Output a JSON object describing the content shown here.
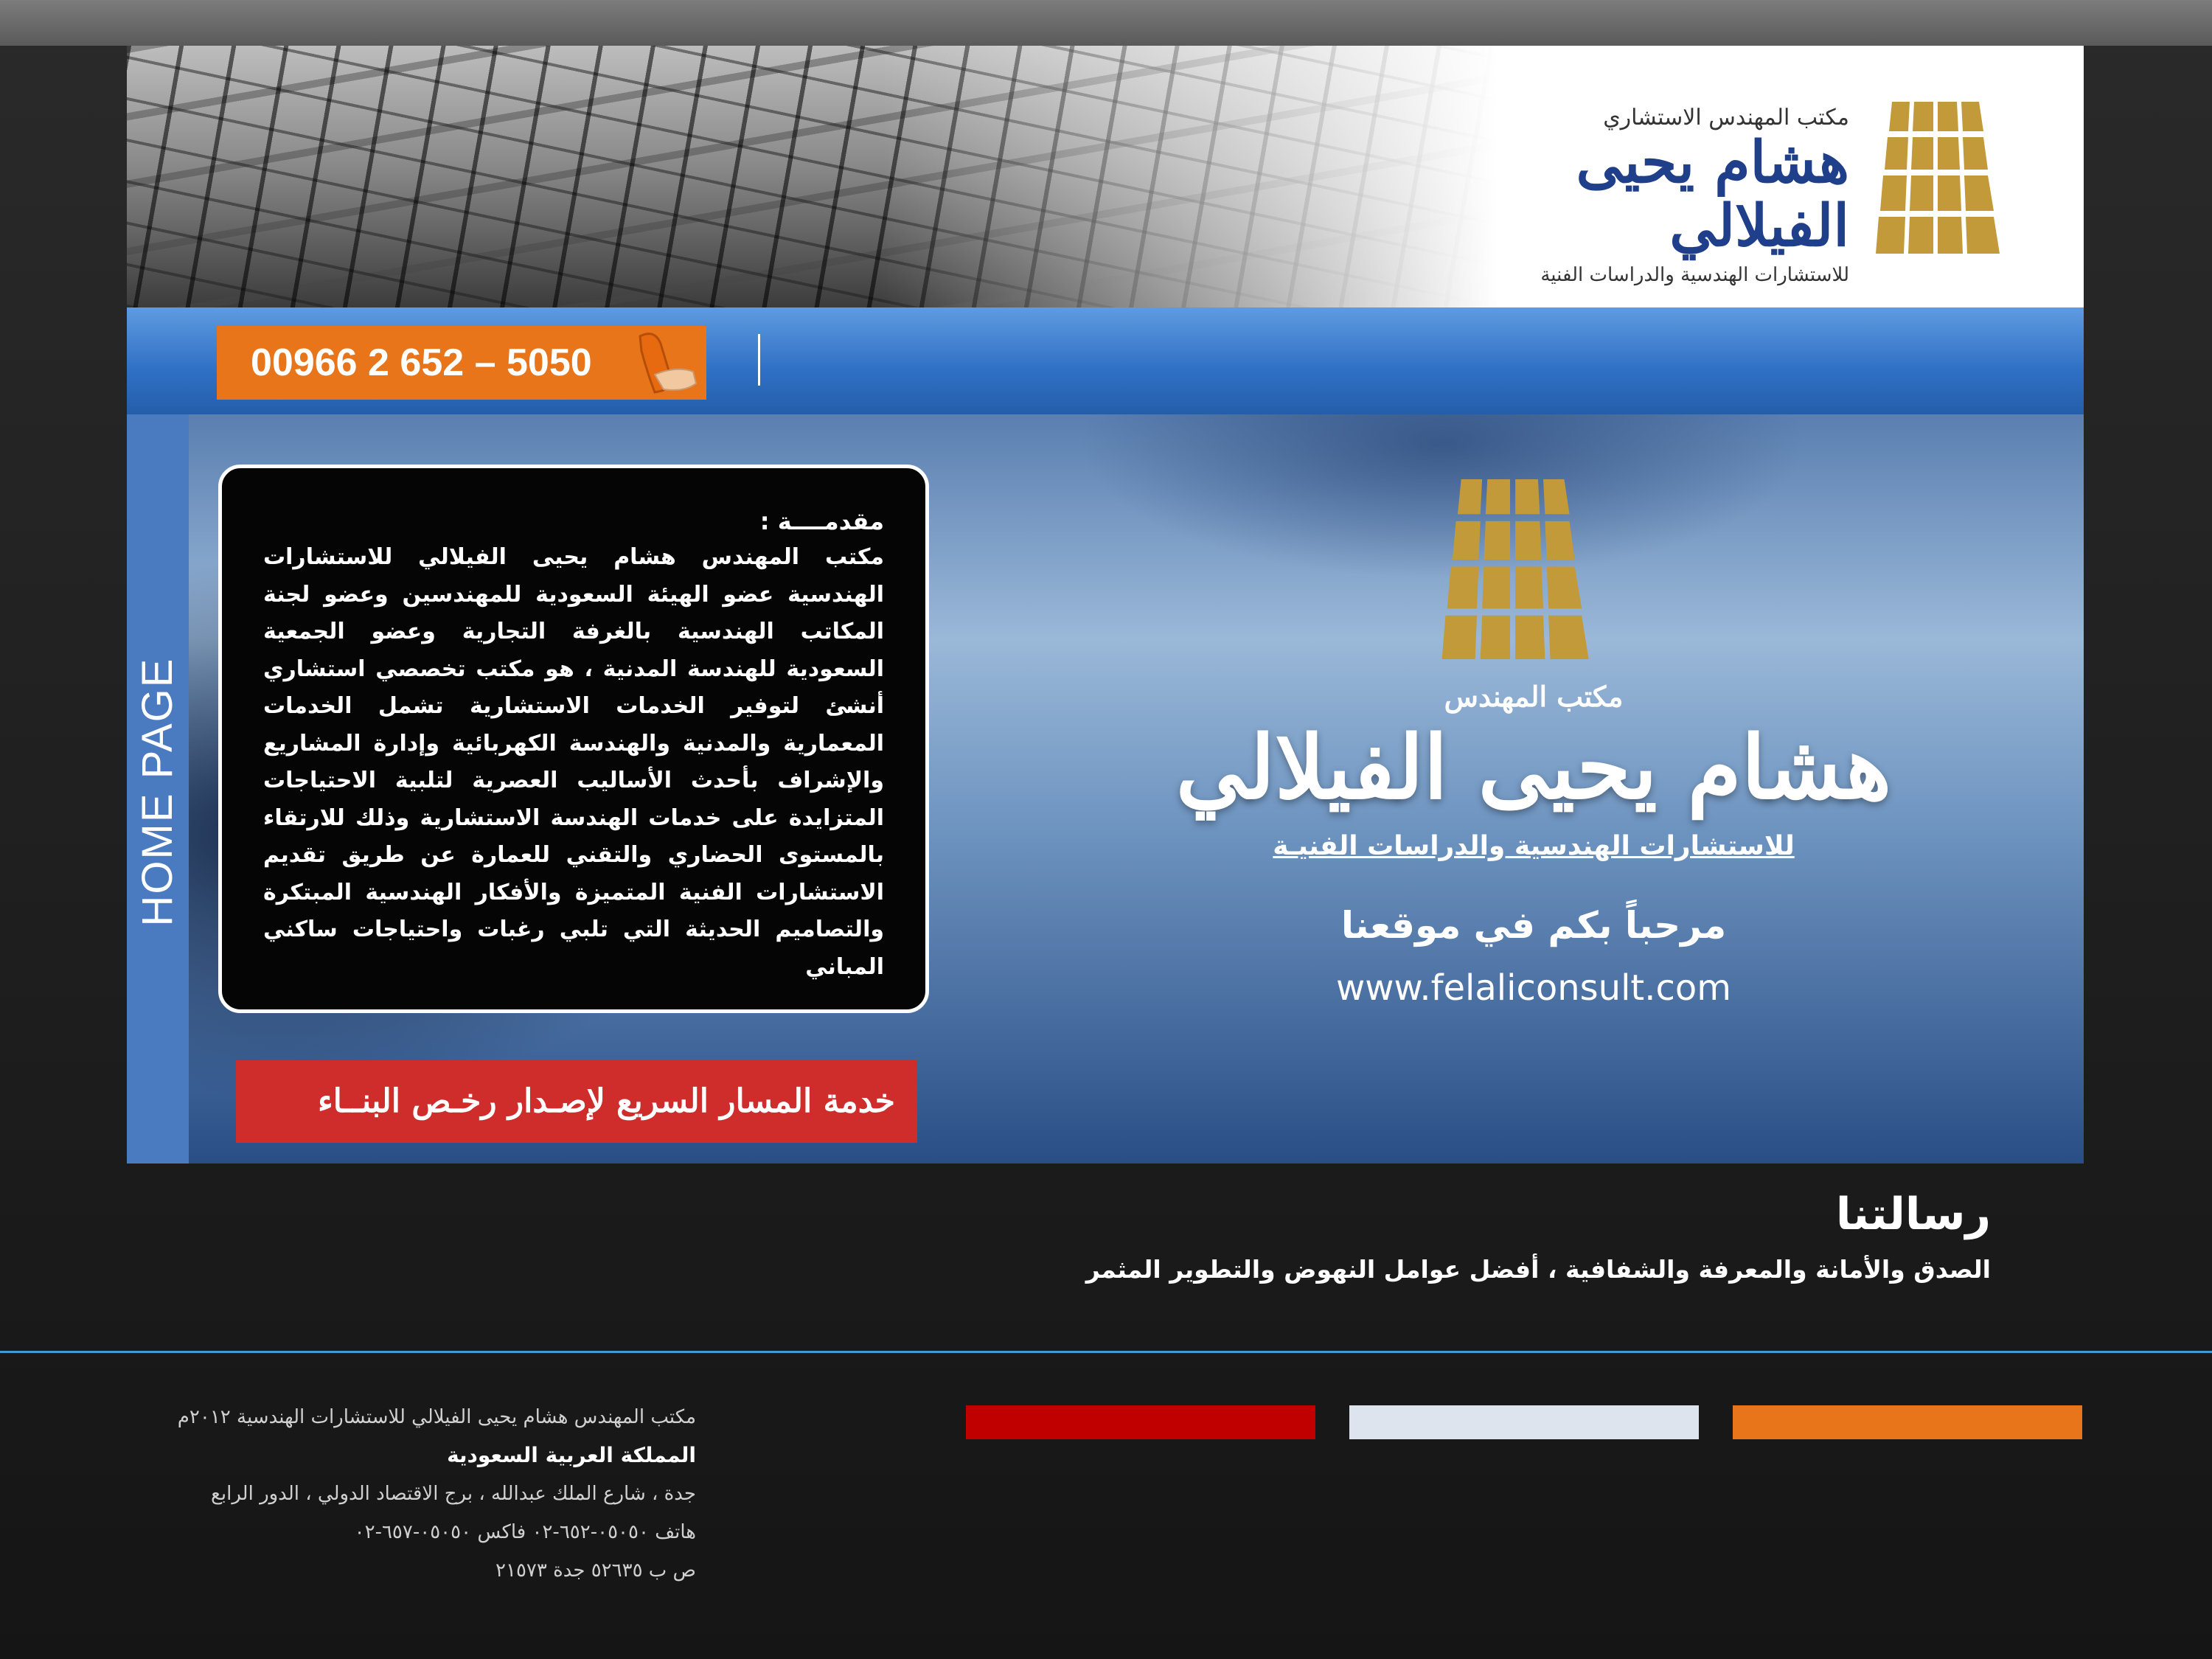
{
  "header": {
    "small_title": "مكتب المهندس الاستشاري",
    "name": "هشام يحيى الفيلالي",
    "subtitle": "للاستشارات الهندسية والدراسات الفنية"
  },
  "nav": {
    "phone": "00966 2 652 – 5050"
  },
  "sidebar": {
    "label": "HOME PAGE"
  },
  "intro": {
    "title": "مقدمــــة :",
    "body": "مكتب المهندس هشام يحيى الفيلالي للاستشارات الهندسية عضو الهيئة السعودية للمهندسين وعضو لجنة المكاتب الهندسية بالغرفة التجارية وعضو الجمعية السعودية للهندسة المدنية ، هو مكتب تخصصي استشاري أنشئ لتوفير الخدمات الاستشارية تشمل الخدمات المعمارية والمدنية والهندسة الكهربائية وإدارة المشاريع والإشراف بأحدث الأساليب العصرية لتلبية الاحتياجات المتزايدة على خدمات الهندسة الاستشارية وذلك للارتقاء بالمستوى الحضاري والتقني للعمارة عن طريق تقديم الاستشارات الفنية المتميزة والأفكار الهندسية المبتكرة والتصاميم الحديثة التي تلبي رغبات واحتياجات ساكني المباني"
  },
  "fast_track": "خدمة المسار السريع لإصـدار رخـص البنــاء",
  "hero": {
    "small_title": "مكتب المهندس",
    "name": "هشام يحيى الفيلالي",
    "subtitle": "للاستشارات الهندسية والدراسات الفنيـة",
    "welcome": "مرحباً بكم في موقعنا",
    "url": "www.felaliconsult.com"
  },
  "mission": {
    "title": "رسالتنا",
    "text": "الصدق والأمانة والمعرفة والشفافية ، أفضل عوامل النهوض والتطوير المثمر"
  },
  "footer": {
    "copyright": "مكتب المهندس هشام يحيى الفيلالي للاستشارات الهندسية ٢٠١٢م",
    "country": "المملكة العربية السعودية",
    "address": "جدة ، شارع الملك عبدالله ، برج الاقتصاد الدولي ، الدور الرابع",
    "phones": "هاتف ٠٥٠٥٠-٦٥٢-٠٢ فاكس ٠٥٠٥٠-٦٥٧-٠٢",
    "pobox": "ص ب ٥٢٦٣٥ جدة ٢١٥٧٣"
  },
  "colors": {
    "nav_blue": "#2f6fc4",
    "phone_orange": "#e8751a",
    "fast_track_red": "#cf2c2c",
    "logo_gold": "#c29a3a",
    "footer_bars": [
      "#c00000",
      "#dde4ee",
      "#e8751a"
    ]
  },
  "icons": {
    "logo": "logo-grid-icon",
    "phone": "phone-hand-icon"
  }
}
